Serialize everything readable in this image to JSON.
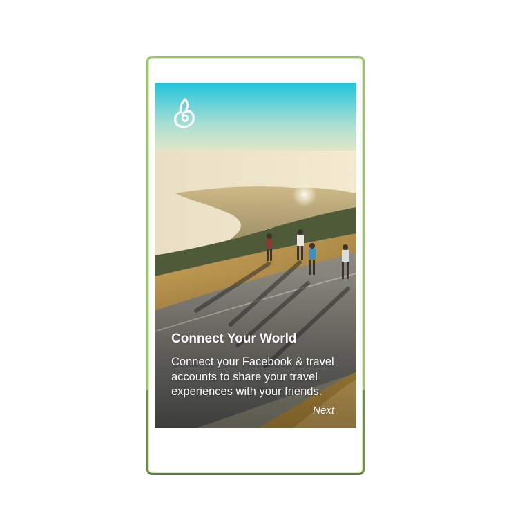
{
  "onboarding": {
    "title": "Connect Your World",
    "description": "Connect your Facebook & travel accounts to share your travel experiences with your friends.",
    "next_label": "Next"
  },
  "icons": {
    "logo": "app-logo-icon"
  },
  "colors": {
    "frame_top": "#9cc46a",
    "frame_bottom": "#5f7d3e",
    "sky": "#2fc3d8",
    "text": "#ffffff"
  }
}
